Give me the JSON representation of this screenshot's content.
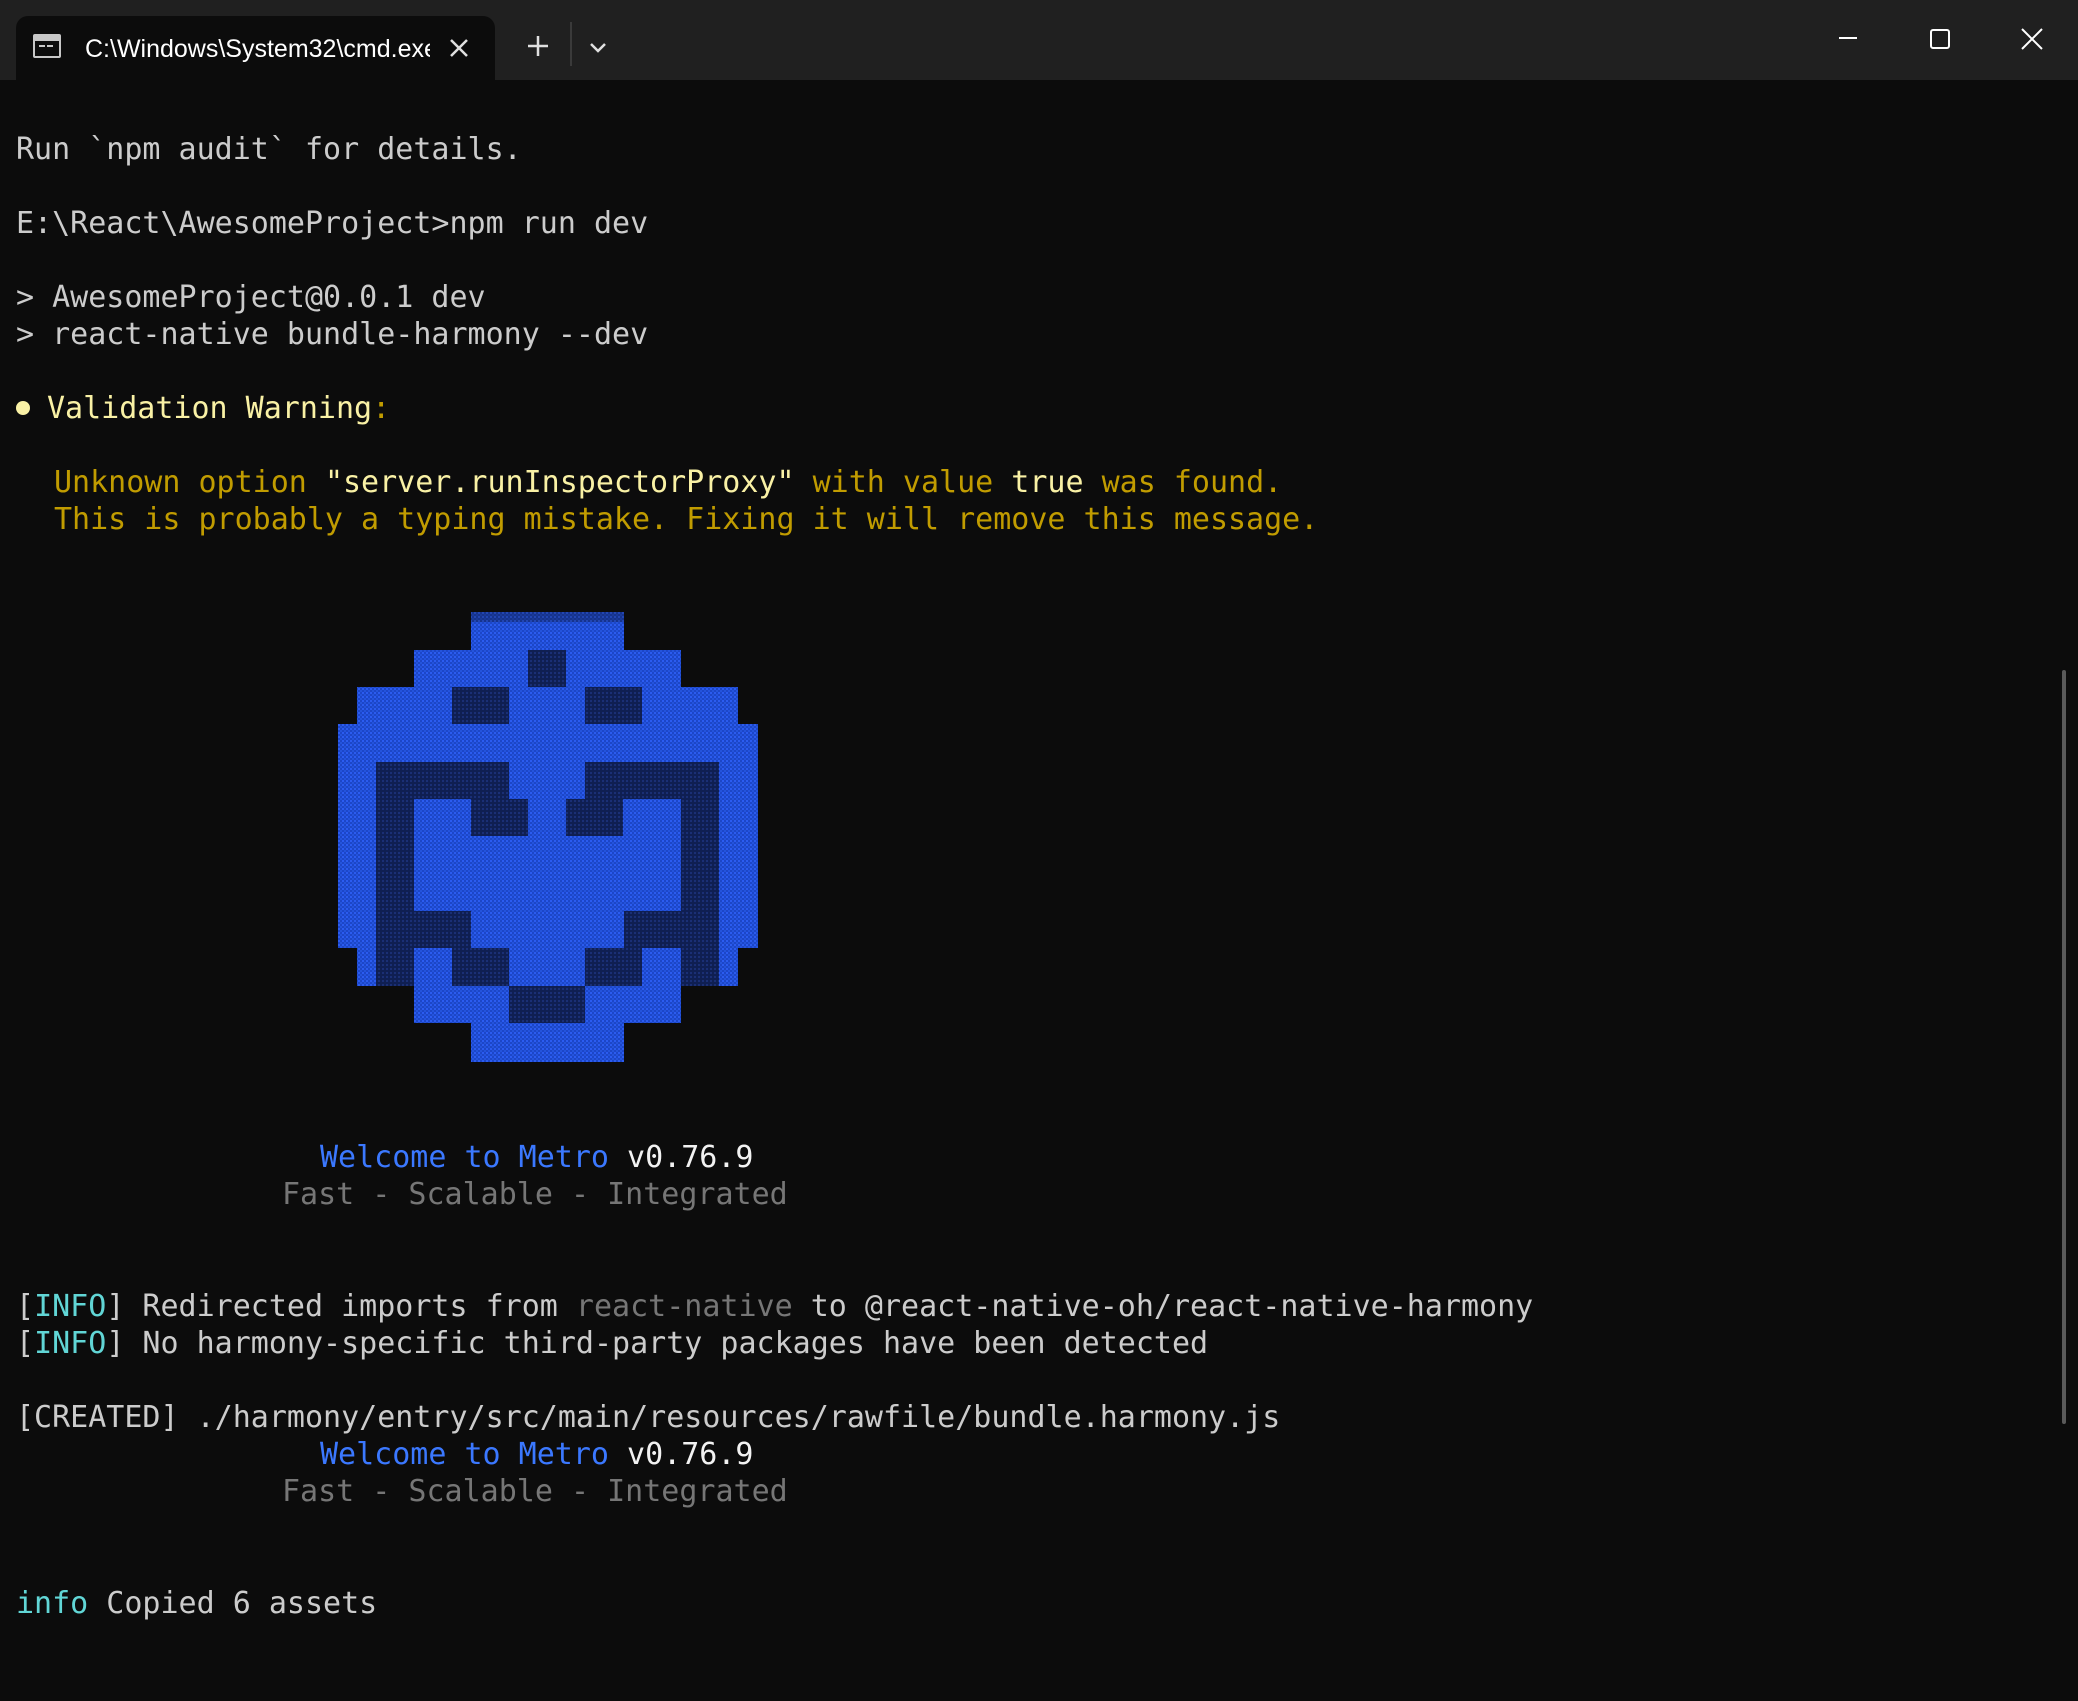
{
  "tab": {
    "title": "C:\\Windows\\System32\\cmd.exe"
  },
  "window_controls": {
    "minimize": "minimize-icon",
    "maximize": "maximize-icon",
    "close": "close-icon"
  },
  "terminal": {
    "audit_line": "Run `npm audit` for details.",
    "prompt_line": "E:\\React\\AwesomeProject>npm run dev",
    "script_line_1": "> AwesomeProject@0.0.1 dev",
    "script_line_2": "> react-native bundle-harmony --dev",
    "warning": {
      "title": "Validation Warning",
      "colon": ":",
      "line1_a": "Unknown option ",
      "line1_option": "\"server.runInspectorProxy\"",
      "line1_b": " with value ",
      "line1_value": "true",
      "line1_c": " was found.",
      "line2": "This is probably a typing mistake. Fixing it will remove this message."
    },
    "metro_welcome_1": {
      "welcome": "Welcome to Metro",
      "version": " v0.76.9",
      "tagline": "Fast - Scalable - Integrated"
    },
    "info_1": {
      "tag_open": "[",
      "tag": "INFO",
      "tag_close": "]",
      "text_a": " Redirected imports from ",
      "text_pkg": "react-native",
      "text_b": " to @react-native-oh/react-native-harmony"
    },
    "info_2": {
      "tag_open": "[",
      "tag": "INFO",
      "tag_close": "]",
      "text": " No harmony-specific third-party packages have been detected"
    },
    "created_line": "[CREATED] ./harmony/entry/src/main/resources/rawfile/bundle.harmony.js",
    "metro_welcome_2": {
      "welcome": "Welcome to Metro",
      "version": " v0.76.9",
      "tagline": "Fast - Scalable - Integrated"
    },
    "copied": {
      "tag": "info",
      "text": " Copied 6 assets"
    }
  },
  "colors": {
    "background": "#0c0c0c",
    "warning_yellow": "#c19c00",
    "highlight_yellow": "#f9f1a5",
    "metro_blue": "#3b78ff",
    "info_cyan": "#61d6d6",
    "tagline_gray": "#767676"
  }
}
